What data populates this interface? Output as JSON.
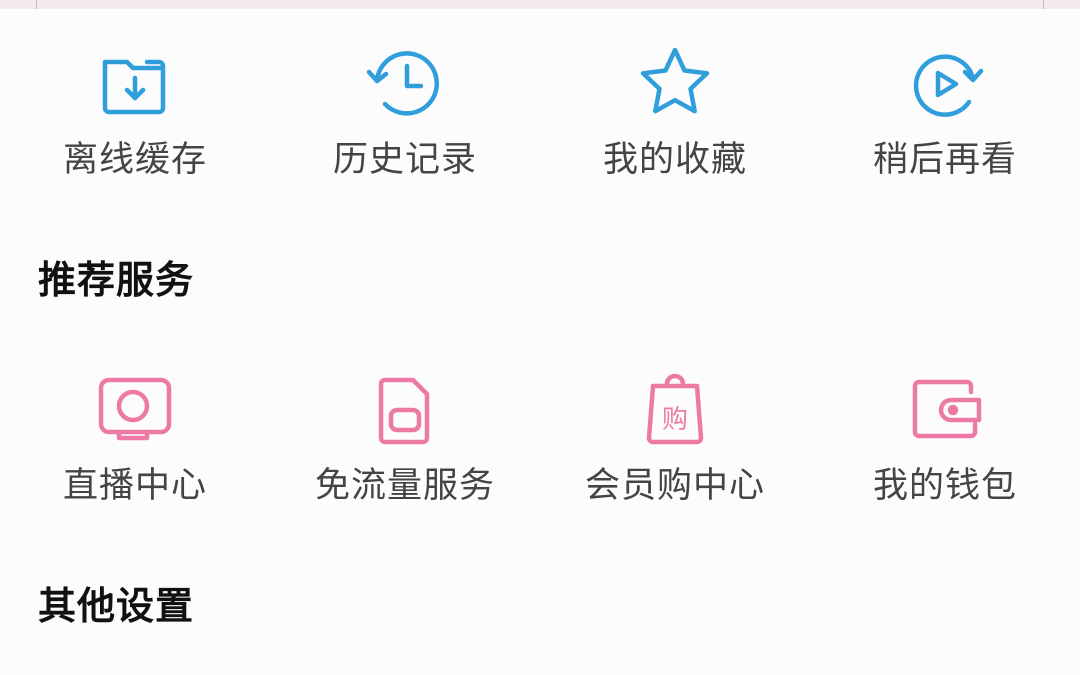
{
  "colors": {
    "blue_icon": "#2f9edb",
    "pink_icon": "#ec7aa5",
    "label_text": "#444444",
    "section_text": "#111111",
    "background": "#fdfcfd"
  },
  "quick_actions": [
    {
      "label": "离线缓存",
      "icon": "download-folder-icon"
    },
    {
      "label": "历史记录",
      "icon": "history-clock-icon"
    },
    {
      "label": "我的收藏",
      "icon": "star-icon"
    },
    {
      "label": "稍后再看",
      "icon": "play-later-icon"
    }
  ],
  "recommended": {
    "title": "推荐服务",
    "items": [
      {
        "label": "直播中心",
        "icon": "live-tv-icon"
      },
      {
        "label": "免流量服务",
        "icon": "sim-card-icon"
      },
      {
        "label": "会员购中心",
        "icon": "shopping-bag-icon",
        "icon_text": "购"
      },
      {
        "label": "我的钱包",
        "icon": "wallet-icon"
      }
    ]
  },
  "other_settings": {
    "title": "其他设置"
  }
}
